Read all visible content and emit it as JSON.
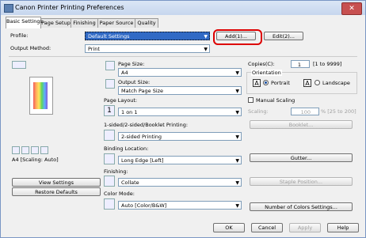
{
  "window": {
    "title": "Canon Printer Printing Preferences",
    "close": "✕"
  },
  "tabs": [
    "Basic Settings",
    "Page Setup",
    "Finishing",
    "Paper Source",
    "Quality"
  ],
  "profile": {
    "label": "Profile:",
    "value": "Default Settings",
    "add_button": "Add(1)...",
    "edit_button": "Edit(2)..."
  },
  "output_method": {
    "label": "Output Method:",
    "value": "Print"
  },
  "page_size": {
    "label": "Page Size:",
    "value": "A4"
  },
  "output_size": {
    "label": "Output Size:",
    "value": "Match Page Size"
  },
  "copies": {
    "label": "Copies(C):",
    "value": "1",
    "range": "[1 to 9999]"
  },
  "orientation": {
    "label": "Orientation",
    "portrait": "Portrait",
    "landscape": "Landscape",
    "selected": "portrait"
  },
  "page_layout": {
    "label": "Page Layout:",
    "value": "1 on 1"
  },
  "manual_scaling": {
    "label": "Manual Scaling",
    "checked": false
  },
  "scaling": {
    "label": "Scaling:",
    "value": "100",
    "range": "% [25 to 200]"
  },
  "booklet_button": "Booklet...",
  "print_mode": {
    "label": "1-sided/2-sided/Booklet Printing:",
    "value": "2-sided Printing"
  },
  "binding": {
    "label": "Binding Location:",
    "value": "Long Edge [Left]"
  },
  "gutter_button": "Gutter...",
  "finishing": {
    "label": "Finishing:",
    "value": "Collate"
  },
  "staple_button": "Staple Position...",
  "color_mode": {
    "label": "Color Mode:",
    "value": "Auto [Color/B&W]"
  },
  "colors_button": "Number of Colors Settings...",
  "preview": {
    "caption": "A4 [Scaling: Auto]"
  },
  "view_settings_button": "View Settings",
  "restore_button": "Restore Defaults",
  "dialog": {
    "ok": "OK",
    "cancel": "Cancel",
    "apply": "Apply",
    "help": "Help"
  },
  "colors": {
    "highlight": "#dd0000",
    "selection": "#316ac5",
    "titlebar": "#c6d6ee"
  }
}
